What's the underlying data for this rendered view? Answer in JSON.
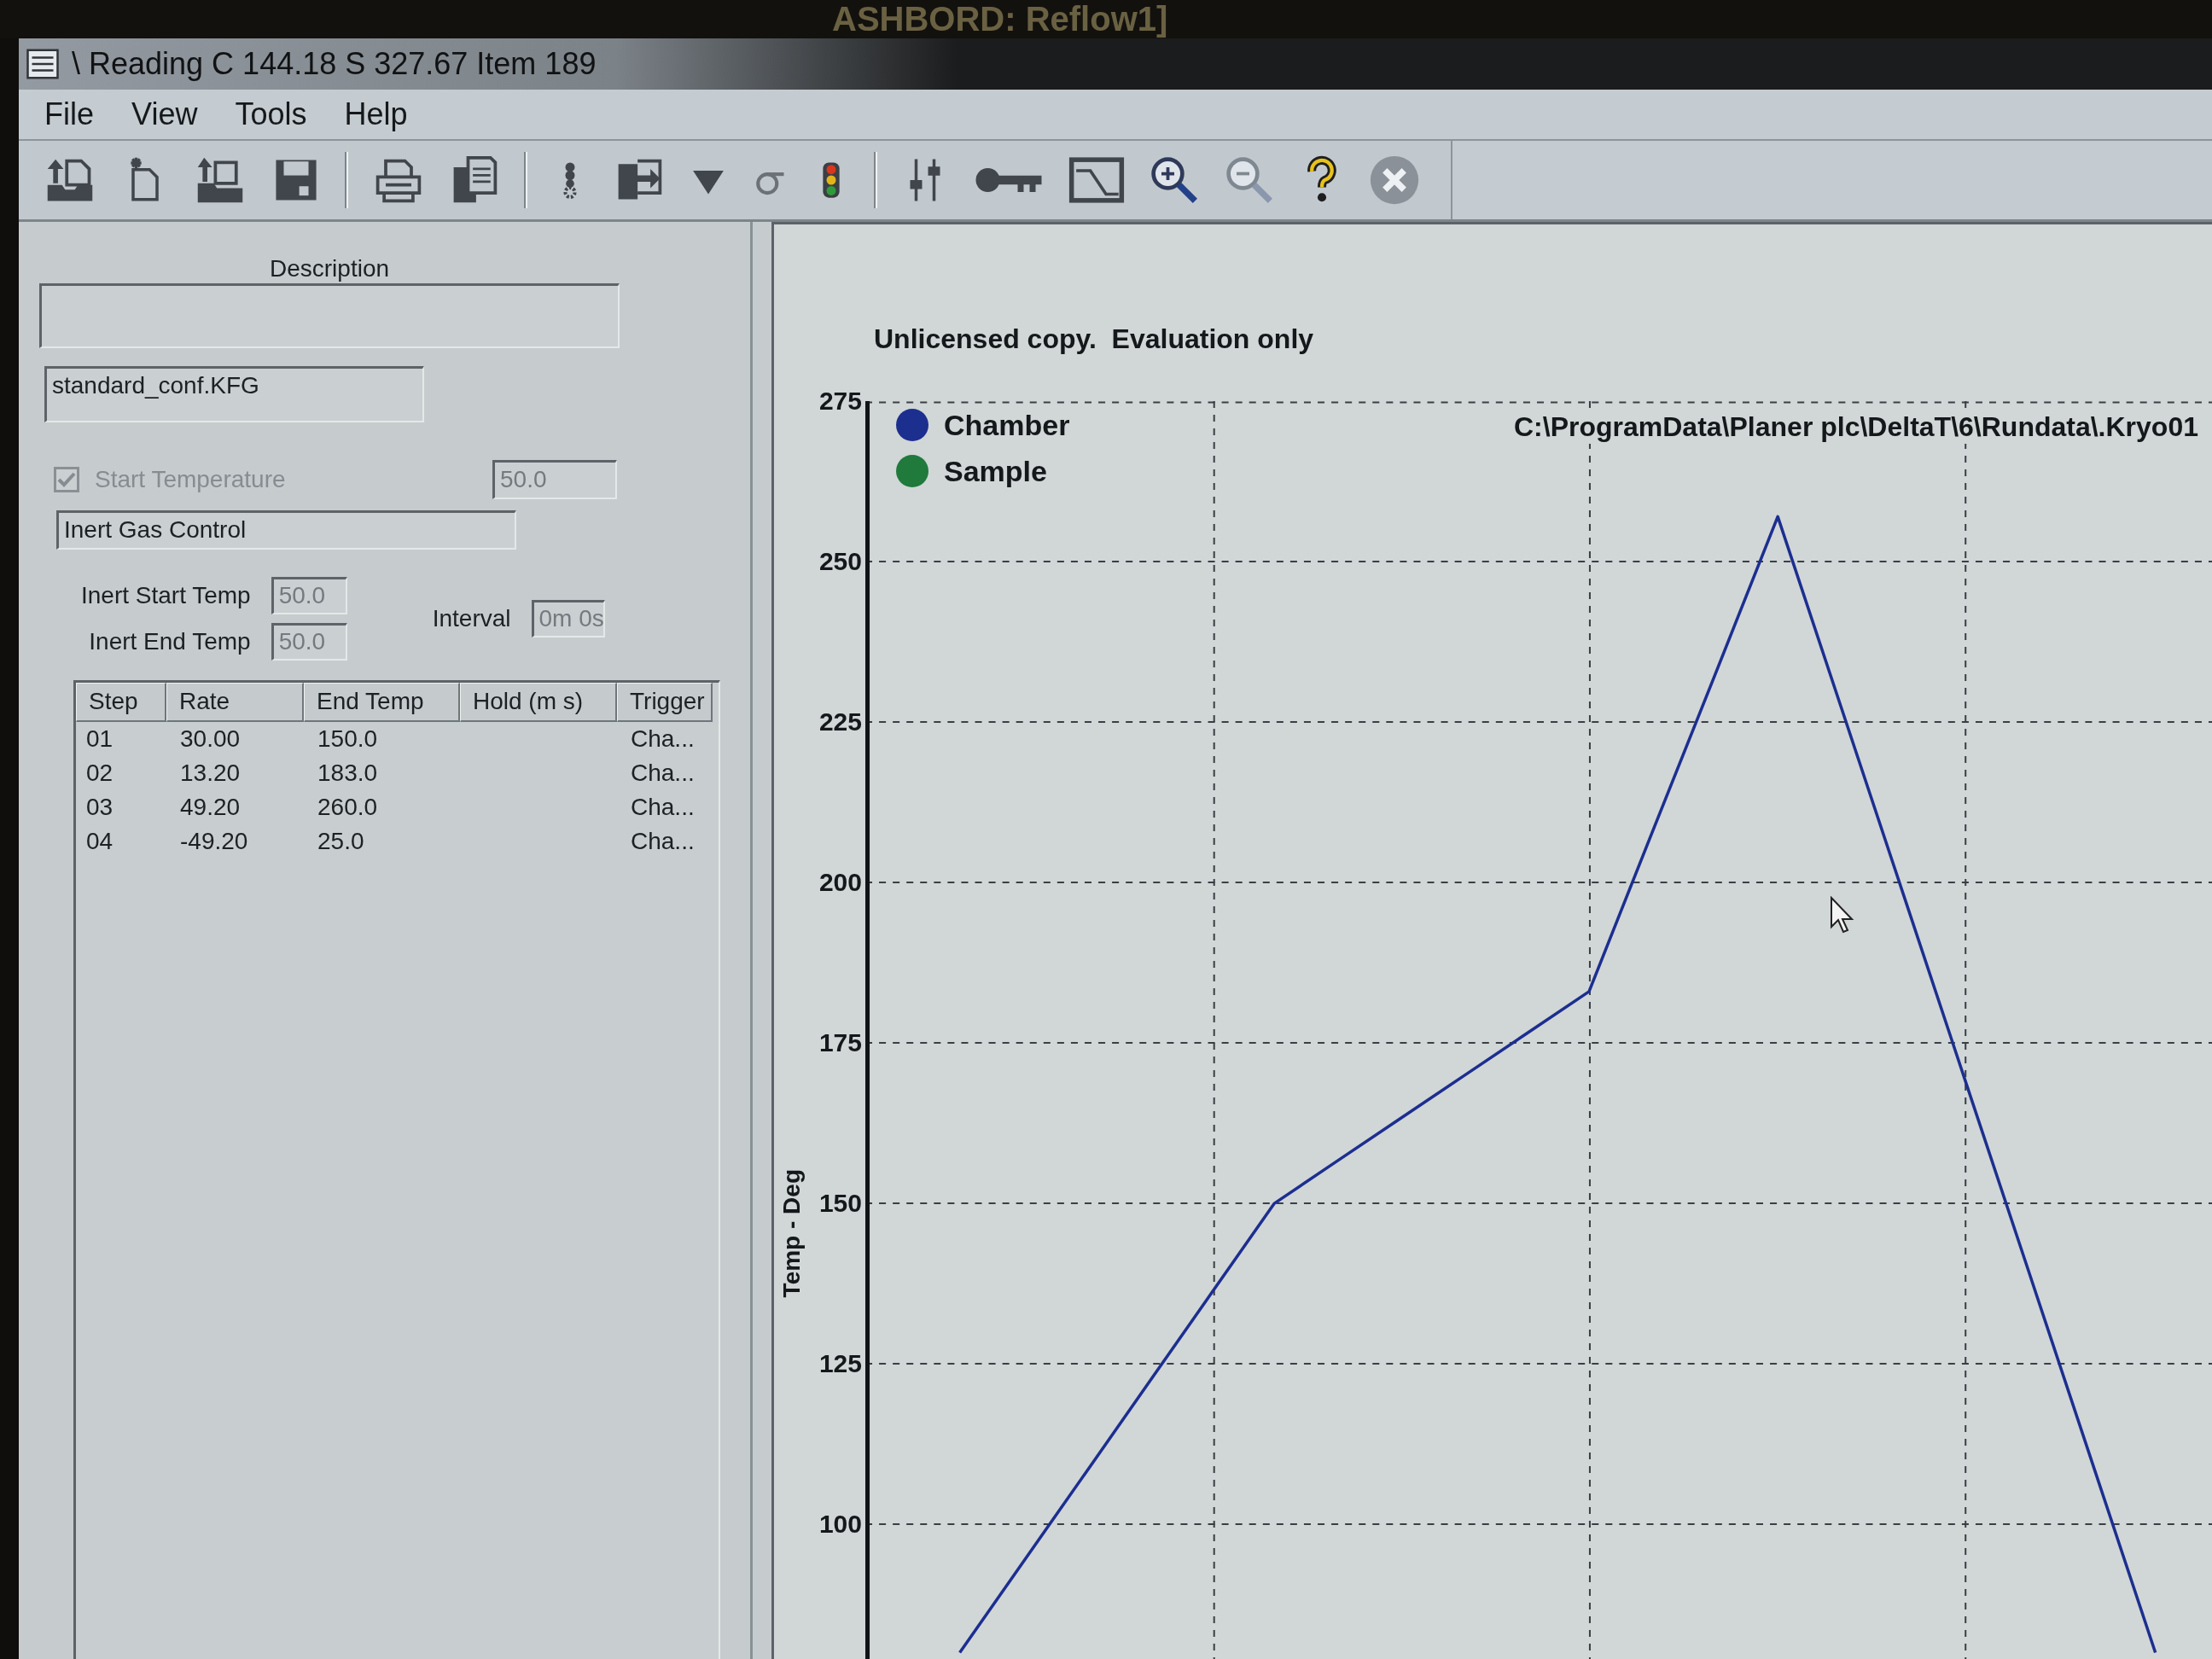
{
  "background_window": {
    "title": "ASHBORD: Reflow1]"
  },
  "window": {
    "title": "\\ Reading C 144.18 S 327.67 Item 189"
  },
  "menu": [
    "File",
    "View",
    "Tools",
    "Help"
  ],
  "description": {
    "label": "Description"
  },
  "config_file": {
    "value": "standard_conf.KFG"
  },
  "start_temperature": {
    "label": "Start Temperature",
    "checked": true,
    "disabled": true,
    "value": "50.0"
  },
  "inert_gas": {
    "title": "Inert Gas Control",
    "start_temp": {
      "label": "Inert Start Temp",
      "value": "50.0",
      "disabled": true
    },
    "interval": {
      "label": "Interval",
      "value": "0m 0s",
      "disabled": true
    },
    "end_temp": {
      "label": "Inert End Temp",
      "value": "50.0",
      "disabled": true
    }
  },
  "steps_table": {
    "columns": [
      "Step",
      "Rate",
      "End Temp",
      "Hold (m s)",
      "Trigger"
    ],
    "rows": [
      [
        "01",
        "30.00",
        "150.0",
        null,
        "Cha..."
      ],
      [
        "02",
        "13.20",
        "183.0",
        null,
        "Cha..."
      ],
      [
        "03",
        "49.20",
        "260.0",
        null,
        "Cha..."
      ],
      [
        "04",
        "-49.20",
        "25.0",
        null,
        "Cha..."
      ]
    ]
  },
  "chart": {
    "notice": "Unlicensed copy.  Evaluation only",
    "file_path": "C:\\ProgramData\\Planer plc\\DeltaT\\6\\Rundata\\.Kryo01",
    "chart_data": {
      "type": "line",
      "ylabel": "Temp - Deg",
      "grid": true,
      "categories": [
        null,
        null,
        null,
        null,
        null,
        null,
        null,
        null,
        null,
        null,
        null,
        null,
        null,
        null,
        null,
        null,
        null,
        null,
        null,
        null
      ],
      "ylim": [
        79,
        275
      ],
      "yticks": [
        100,
        125,
        150,
        175,
        200,
        225,
        250,
        275
      ],
      "series": [
        {
          "name": "Chamber",
          "color": "#1c2f8f",
          "values": [
            80,
            94,
            108,
            122,
            136,
            150,
            156.6,
            163.2,
            169.8,
            176.4,
            183,
            207.7,
            232.3,
            257,
            227.5,
            198,
            168.5,
            139,
            109.5,
            80
          ]
        },
        {
          "name": "Sample",
          "color": "#1f7a3c",
          "values": [
            null,
            null,
            null,
            null,
            null,
            null,
            null,
            null,
            null,
            null,
            null,
            null,
            null,
            null,
            null,
            null,
            null,
            null,
            null,
            null
          ]
        }
      ]
    }
  }
}
